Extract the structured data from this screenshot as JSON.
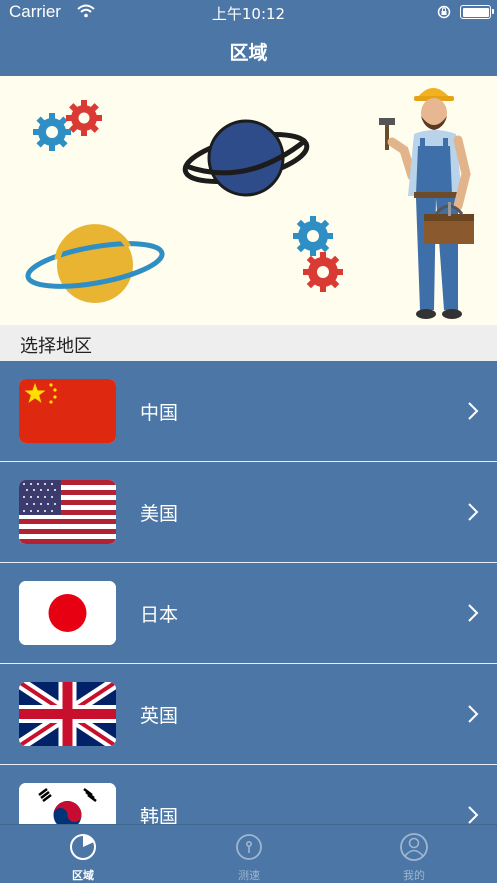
{
  "status_bar": {
    "carrier": "Carrier",
    "time": "上午10:12"
  },
  "nav": {
    "title": "区域"
  },
  "section": {
    "header": "选择地区"
  },
  "regions": [
    {
      "label": "中国",
      "flag": "china-flag-icon"
    },
    {
      "label": "美国",
      "flag": "usa-flag-icon"
    },
    {
      "label": "日本",
      "flag": "japan-flag-icon"
    },
    {
      "label": "英国",
      "flag": "uk-flag-icon"
    },
    {
      "label": "韩国",
      "flag": "korea-flag-icon"
    }
  ],
  "tabs": [
    {
      "label": "区域",
      "icon": "pie-chart-icon",
      "active": true
    },
    {
      "label": "测速",
      "icon": "gauge-icon",
      "active": false
    },
    {
      "label": "我的",
      "icon": "user-icon",
      "active": false
    }
  ],
  "colors": {
    "primary": "#4c76a6",
    "hero_bg": "#fffdee",
    "section_bg": "#eeeeee"
  }
}
